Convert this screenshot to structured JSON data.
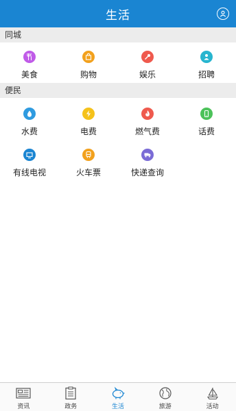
{
  "header": {
    "title": "生活",
    "user_icon": "user-icon"
  },
  "sections": [
    {
      "label": "同城",
      "items": [
        {
          "label": "美食",
          "icon": "fork-knife-icon",
          "color": "#c05be8"
        },
        {
          "label": "购物",
          "icon": "shopping-bag-icon",
          "color": "#f2a11d"
        },
        {
          "label": "娱乐",
          "icon": "microphone-icon",
          "color": "#ef5a4e"
        },
        {
          "label": "招聘",
          "icon": "person-icon",
          "color": "#27b5cf"
        }
      ]
    },
    {
      "label": "便民",
      "items": [
        {
          "label": "水费",
          "icon": "water-drop-icon",
          "color": "#2f9be0"
        },
        {
          "label": "电费",
          "icon": "lightning-icon",
          "color": "#f5c21b"
        },
        {
          "label": "燃气费",
          "icon": "flame-icon",
          "color": "#ef5a4e"
        },
        {
          "label": "话费",
          "icon": "phone-icon",
          "color": "#4cc25a"
        },
        {
          "label": "有线电视",
          "icon": "tv-icon",
          "color": "#1a85d2"
        },
        {
          "label": "火车票",
          "icon": "train-icon",
          "color": "#f2a11d"
        },
        {
          "label": "快递查询",
          "icon": "delivery-truck-icon",
          "color": "#7a6bd6"
        }
      ]
    }
  ],
  "tabbar": {
    "active": "生活",
    "active_color": "#1a85d2",
    "tabs": [
      {
        "label": "资讯",
        "icon": "newspaper-icon"
      },
      {
        "label": "政务",
        "icon": "clipboard-icon"
      },
      {
        "label": "生活",
        "icon": "piggy-bank-icon"
      },
      {
        "label": "旅游",
        "icon": "globe-icon"
      },
      {
        "label": "活动",
        "icon": "sailboat-icon"
      }
    ]
  },
  "colors": {
    "header_bg": "#1a85d2",
    "section_bg": "#ececec"
  }
}
